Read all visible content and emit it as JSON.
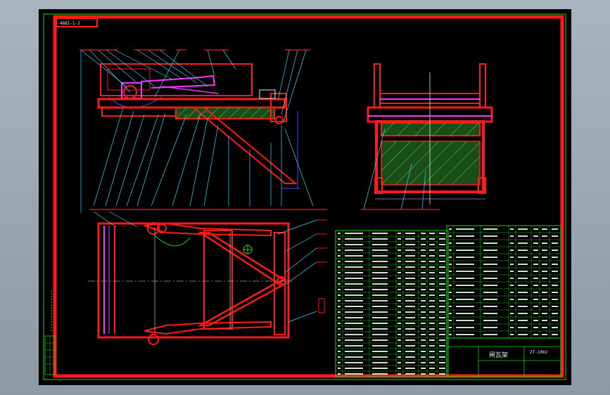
{
  "drawing_label": "4881-1-2",
  "title_block": {
    "drawing_title": "闸瓦架",
    "drawing_number": "ZT-1002"
  },
  "bom": {
    "left_rows": 26,
    "right_rows": 16
  },
  "colors": {
    "background": "#000000",
    "frame": "#ff1a1a",
    "grid": "#19d219",
    "accent": "#ff33ff",
    "leader": "#33d9ff",
    "text": "#e8e8e8"
  }
}
